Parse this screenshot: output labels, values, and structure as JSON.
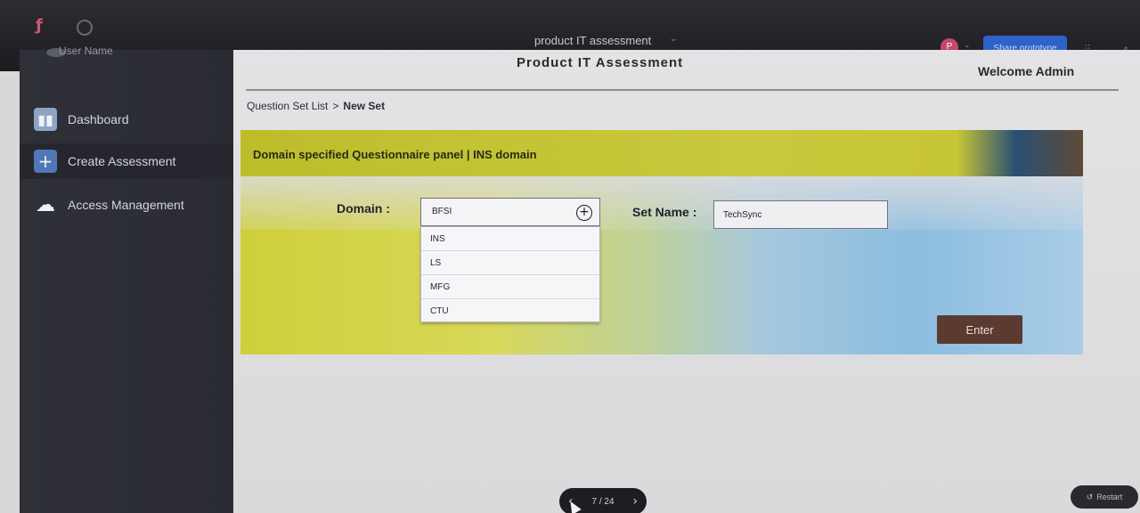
{
  "viewer": {
    "title": "product IT assessment",
    "avatar_initial": "P",
    "share_label": "Share prototype",
    "page_count": "7 / 24",
    "restart_label": "Restart"
  },
  "sidebar": {
    "user_name": "User Name",
    "items": [
      {
        "label": "Dashboard",
        "icon": "dashboard-icon"
      },
      {
        "label": "Create Assessment",
        "icon": "plus-icon"
      },
      {
        "label": "Access Management",
        "icon": "cloud-icon"
      }
    ]
  },
  "header": {
    "title": "Product IT Assessment",
    "welcome": "Welcome Admin"
  },
  "breadcrumb": {
    "parent": "Question Set List",
    "separator": ">",
    "current": "New Set"
  },
  "panel": {
    "title": "Domain specified Questionnaire panel | INS domain",
    "domain_label": "Domain :",
    "domain_value": "BFSI",
    "domain_options": [
      "INS",
      "LS",
      "MFG",
      "CTU"
    ],
    "set_name_label": "Set Name :",
    "set_name_value": "TechSync",
    "enter_label": "Enter"
  },
  "colors": {
    "sidebar_bg": "#2f3038",
    "panel_header": "#c9c93c",
    "enter_button": "#5b3a30",
    "share_button": "#2d63c8"
  }
}
